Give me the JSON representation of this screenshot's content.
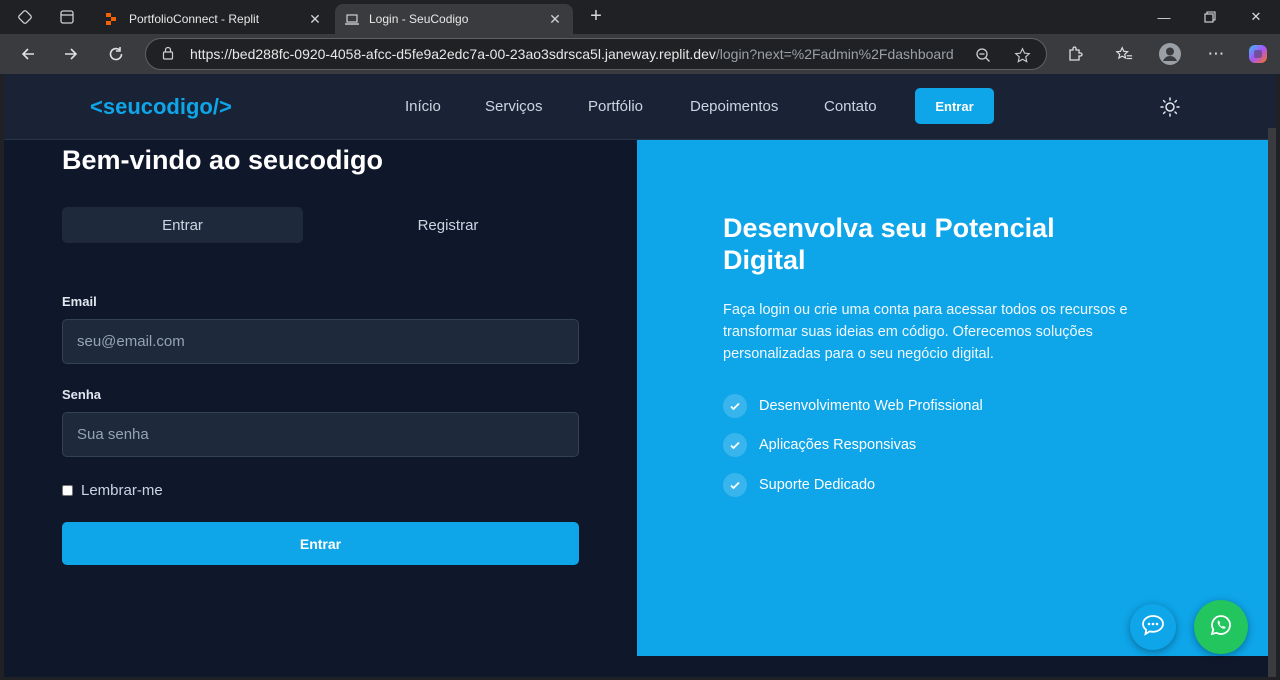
{
  "browser": {
    "tabs": [
      {
        "title": "PortfolioConnect - Replit",
        "active": false,
        "icon": "replit-icon"
      },
      {
        "title": "Login - SeuCodigo",
        "active": true,
        "icon": "laptop-icon"
      }
    ],
    "url_host": "https://bed288fc-0920-4058-afcc-d5fe9a2edc7a-00-23ao3sdrsca5l.janeway.replit.dev",
    "url_path": "/login?next=%2Fadmin%2Fdashboard"
  },
  "site": {
    "logo": "<seucodigo/>",
    "nav": [
      "Início",
      "Serviços",
      "Portfólio",
      "Depoimentos",
      "Contato"
    ],
    "nav_cta": "Entrar",
    "theme_icon": "sun-icon"
  },
  "login": {
    "title": "Bem-vindo ao seucodigo",
    "tab_login": "Entrar",
    "tab_register": "Registrar",
    "email_label": "Email",
    "email_placeholder": "seu@email.com",
    "password_label": "Senha",
    "password_placeholder": "Sua senha",
    "remember_label": "Lembrar-me",
    "submit_label": "Entrar"
  },
  "hero": {
    "title": "Desenvolva seu Potencial Digital",
    "text": "Faça login ou crie uma conta para acessar todos os recursos e transformar suas ideias em código. Oferecemos soluções personalizadas para o seu negócio digital.",
    "features": [
      "Desenvolvimento Web Profissional",
      "Aplicações Responsivas",
      "Suporte Dedicado"
    ]
  },
  "colors": {
    "accent": "#0ea5e9",
    "background": "#0f172a",
    "whatsapp": "#22c55e"
  }
}
